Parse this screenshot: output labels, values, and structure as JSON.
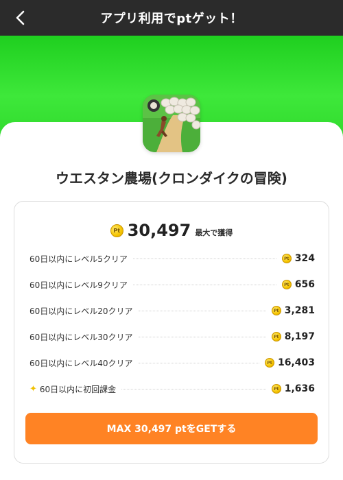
{
  "header": {
    "title": "アプリ利用でptゲット！"
  },
  "app": {
    "name": "ウエスタン農場(クロンダイクの冒険)"
  },
  "summary": {
    "coin_label": "Pt",
    "total": "30,497",
    "suffix": "最大で獲得"
  },
  "rewards": [
    {
      "label": "60日以内にレベル5クリア",
      "points": "324"
    },
    {
      "label": "60日以内にレベル9クリア",
      "points": "656"
    },
    {
      "label": "60日以内にレベル20クリア",
      "points": "3,281"
    },
    {
      "label": "60日以内にレベル30クリア",
      "points": "8,197"
    },
    {
      "label": "60日以内にレベル40クリア",
      "points": "16,403"
    },
    {
      "label": "60日以内に初回課金",
      "points": "1,636"
    }
  ],
  "cta": {
    "label": "MAX 30,497 ptをGETする"
  },
  "colors": {
    "header_bg": "#2b2b2b",
    "hero_green": "#2fd82c",
    "cta_orange": "#ff8324",
    "coin_gold": "#f5c400"
  },
  "icons": {
    "back": "chevron-left-icon",
    "coin": "pt-coin-icon",
    "special": "sparkle-icon",
    "app": "app-icon"
  }
}
